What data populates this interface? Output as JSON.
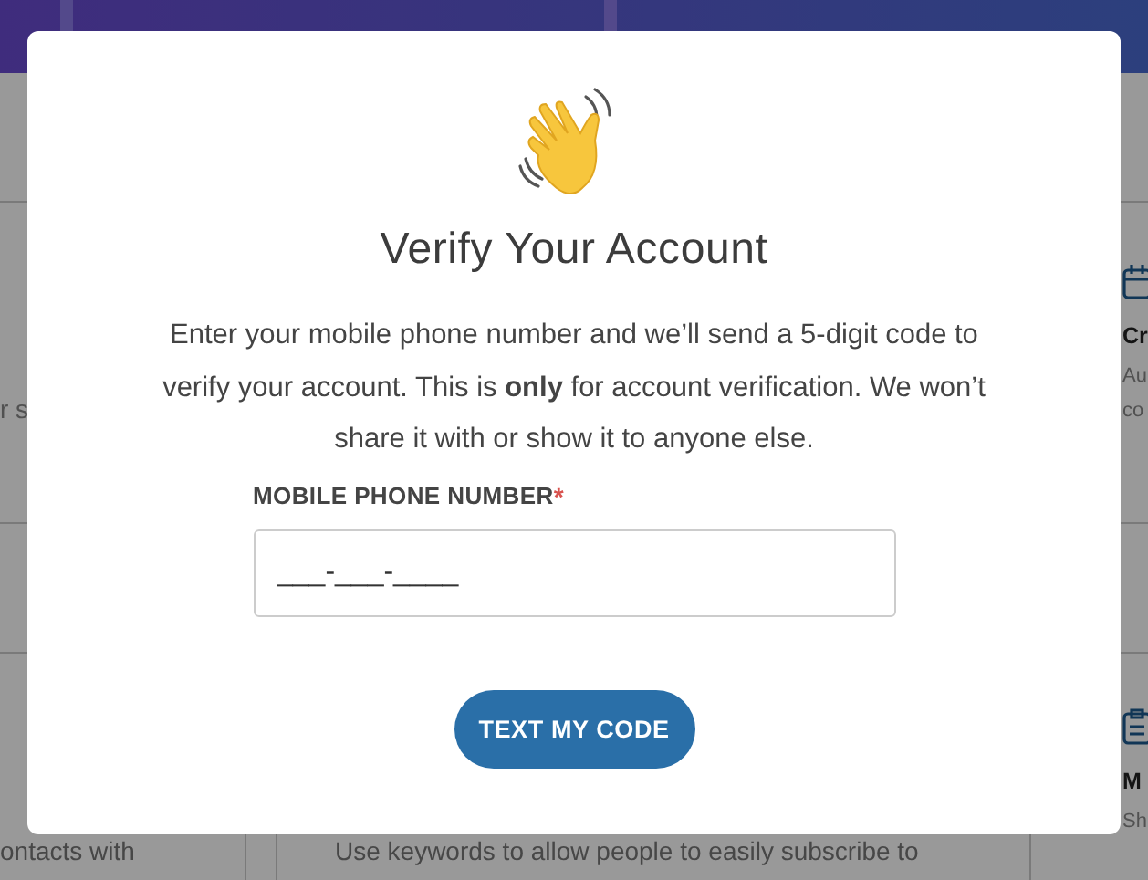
{
  "background": {
    "left_texts": [
      "r s",
      "ontacts with"
    ],
    "middle_texts": [
      "Use keywords to allow people to easily subscribe to"
    ],
    "right_cards": [
      {
        "kind": "calendar",
        "title": "Cr",
        "lines": [
          "Au",
          "co"
        ]
      },
      {
        "kind": "clipboard",
        "title": "M",
        "lines": [
          "Sh"
        ]
      }
    ]
  },
  "modal": {
    "title": "Verify Your Account",
    "body": "Enter your mobile phone number and we’ll send a 5-digit code to verify your account. This is **only** for account verification. We won’t share it with or show it to anyone else.",
    "field": {
      "label": "MOBILE PHONE NUMBER",
      "required": true,
      "required_mark": "*",
      "placeholder": "___-___-____"
    },
    "button": "TEXT MY CODE"
  }
}
